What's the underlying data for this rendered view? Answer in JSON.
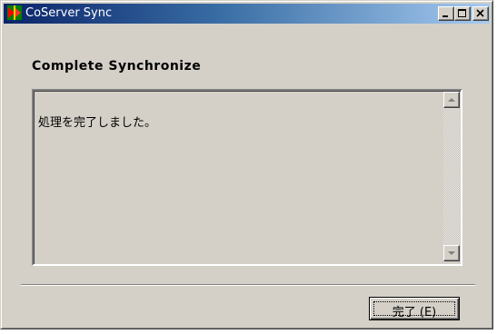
{
  "window": {
    "title": "CoServer Sync",
    "icon": "coserver-app-icon"
  },
  "titlebar_buttons": {
    "minimize": "minimize-icon",
    "maximize": "maximize-icon",
    "close": "close-icon"
  },
  "dialog": {
    "heading": "Complete Synchronize",
    "message": "処理を完了しました。",
    "finish_label": "完了 (E)"
  },
  "colors": {
    "titlebar_start": "#0a246a",
    "titlebar_end": "#a6caf0",
    "face": "#d4d0c8"
  }
}
